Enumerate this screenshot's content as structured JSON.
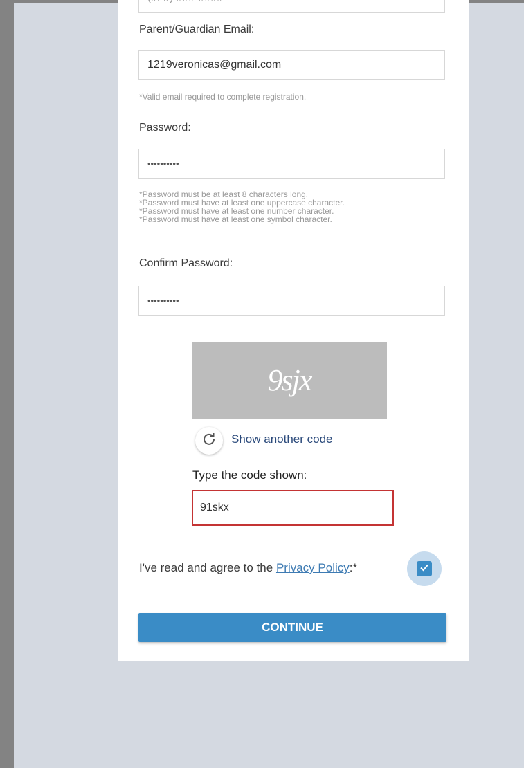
{
  "form": {
    "phone_partial_value": "(###) ###-####",
    "parent_email_label": "Parent/Guardian Email:",
    "parent_email_value": "1219veronicas@gmail.com",
    "email_hint": "*Valid email required to complete registration.",
    "password_label": "Password:",
    "password_value": "••••••••••",
    "password_hints": [
      "*Password must be at least 8 characters long.",
      "*Password must have at least one uppercase character.",
      "*Password must have at least one number character.",
      "*Password must have at least one symbol character."
    ],
    "confirm_password_label": "Confirm Password:",
    "confirm_password_value": "••••••••••",
    "captcha": {
      "image_text": "9sjx",
      "show_another_label": "Show another code",
      "type_code_label": "Type the code shown:",
      "code_value": "91skx"
    },
    "agree_text_prefix": "I've read and agree to the ",
    "privacy_policy_link": "Privacy Policy",
    "agree_text_suffix": ":*",
    "agree_checked": true,
    "continue_label": "CONTINUE"
  },
  "colors": {
    "accent": "#3a8cc6",
    "error_border": "#c43434",
    "page_bg": "#d4d9e1"
  }
}
